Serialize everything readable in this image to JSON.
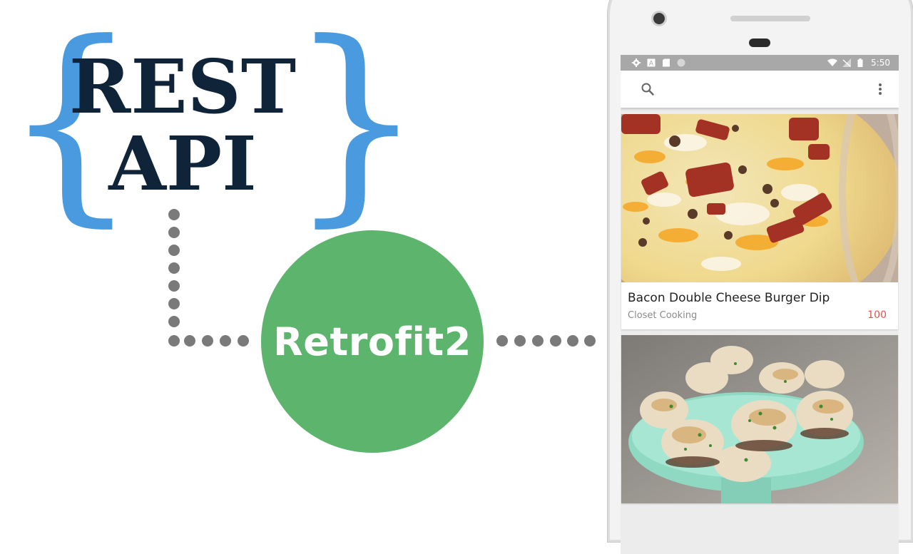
{
  "illustration": {
    "open_brace": "{",
    "close_brace": "}",
    "title_line1": "REST",
    "title_line2": "API",
    "library_label": "Retrofit2",
    "colors": {
      "brace": "#4a9ae0",
      "title": "#0f2339",
      "circle": "#5db46d",
      "dots": "#7a7a7a"
    }
  },
  "status_bar": {
    "left_icons": [
      "gear-icon",
      "a-icon",
      "sd-card-icon",
      "circle-icon"
    ],
    "right_icons": [
      "wifi-icon",
      "no-signal-icon",
      "battery-icon"
    ],
    "time": "5:50"
  },
  "toolbar": {
    "left_icon": "search-icon",
    "right_icon": "overflow-menu-icon"
  },
  "recipes": [
    {
      "title": "Bacon Double Cheese Burger Dip",
      "publisher": "Closet Cooking",
      "rank": "100",
      "image": "cheesy-dip-photo"
    },
    {
      "title": "",
      "publisher": "",
      "rank": "",
      "image": "stuffed-mushrooms-photo"
    }
  ],
  "accent": {
    "rank_color": "#e25252"
  }
}
